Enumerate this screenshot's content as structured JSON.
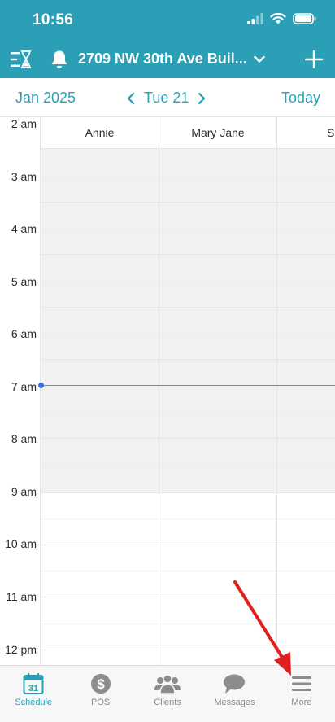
{
  "status": {
    "time": "10:56"
  },
  "header": {
    "location": "2709 NW 30th Ave Buil...",
    "icons": [
      "waitlist-icon",
      "bell-icon",
      "chevron-down-icon",
      "plus-icon"
    ]
  },
  "datebar": {
    "month": "Jan 2025",
    "day": "Tue 21",
    "today_label": "Today"
  },
  "grid": {
    "staff": [
      "Annie",
      "Mary Jane",
      "Sim"
    ],
    "hours": [
      "2 am",
      "3 am",
      "4 am",
      "5 am",
      "6 am",
      "7 am",
      "8 am",
      "9 am",
      "10 am",
      "11 am",
      "12 pm"
    ]
  },
  "tabs": [
    {
      "label": "Schedule",
      "icon": "calendar-icon",
      "badge": "31",
      "active": true
    },
    {
      "label": "POS",
      "icon": "dollar-icon",
      "active": false
    },
    {
      "label": "Clients",
      "icon": "clients-icon",
      "active": false
    },
    {
      "label": "Messages",
      "icon": "chat-icon",
      "active": false
    },
    {
      "label": "More",
      "icon": "menu-icon",
      "active": false
    }
  ],
  "colors": {
    "accent": "#2a9fb6",
    "now_line": "#2f6fe8",
    "annotation_arrow": "#e02020"
  }
}
